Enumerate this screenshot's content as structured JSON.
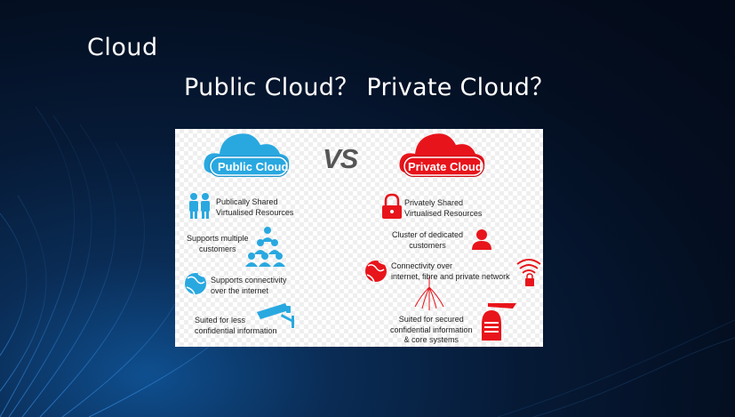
{
  "slide": {
    "title": "Cloud",
    "subtitle": "Public Cloud？ Private Cloud？"
  },
  "colors": {
    "public_accent": "#29a8e0",
    "private_accent": "#e8141b",
    "vs_gray": "#555555",
    "background": "#061a36"
  },
  "comparison": {
    "vs_label": "VS",
    "public": {
      "label": "Public Cloud",
      "icon": "cloud-icon",
      "features": [
        {
          "icon": "people-pair-icon",
          "lines": [
            "Publically Shared",
            "Virtualised Resources"
          ]
        },
        {
          "icon": "people-group-icon",
          "lines": [
            "Supports multiple",
            "customers"
          ]
        },
        {
          "icon": "globe-icon",
          "lines": [
            "Supports connectivity",
            "over the internet"
          ]
        },
        {
          "icon": "security-camera-icon",
          "lines": [
            "Suited for less",
            "confidential information"
          ]
        }
      ]
    },
    "private": {
      "label": "Private Cloud",
      "icon": "cloud-icon",
      "features": [
        {
          "icon": "padlock-icon",
          "lines": [
            "Privately Shared",
            "Virtualised Resources"
          ]
        },
        {
          "icon": "person-icon",
          "lines": [
            "Cluster of dedicated",
            "customers"
          ]
        },
        {
          "icon": "globe-wifi-lock-icon",
          "lines": [
            "Connectivity over",
            "internet, fibre and private network"
          ]
        },
        {
          "icon": "knight-helmet-icon",
          "lines": [
            "Suited for secured",
            "confidential information",
            "& core systems"
          ]
        }
      ]
    }
  }
}
